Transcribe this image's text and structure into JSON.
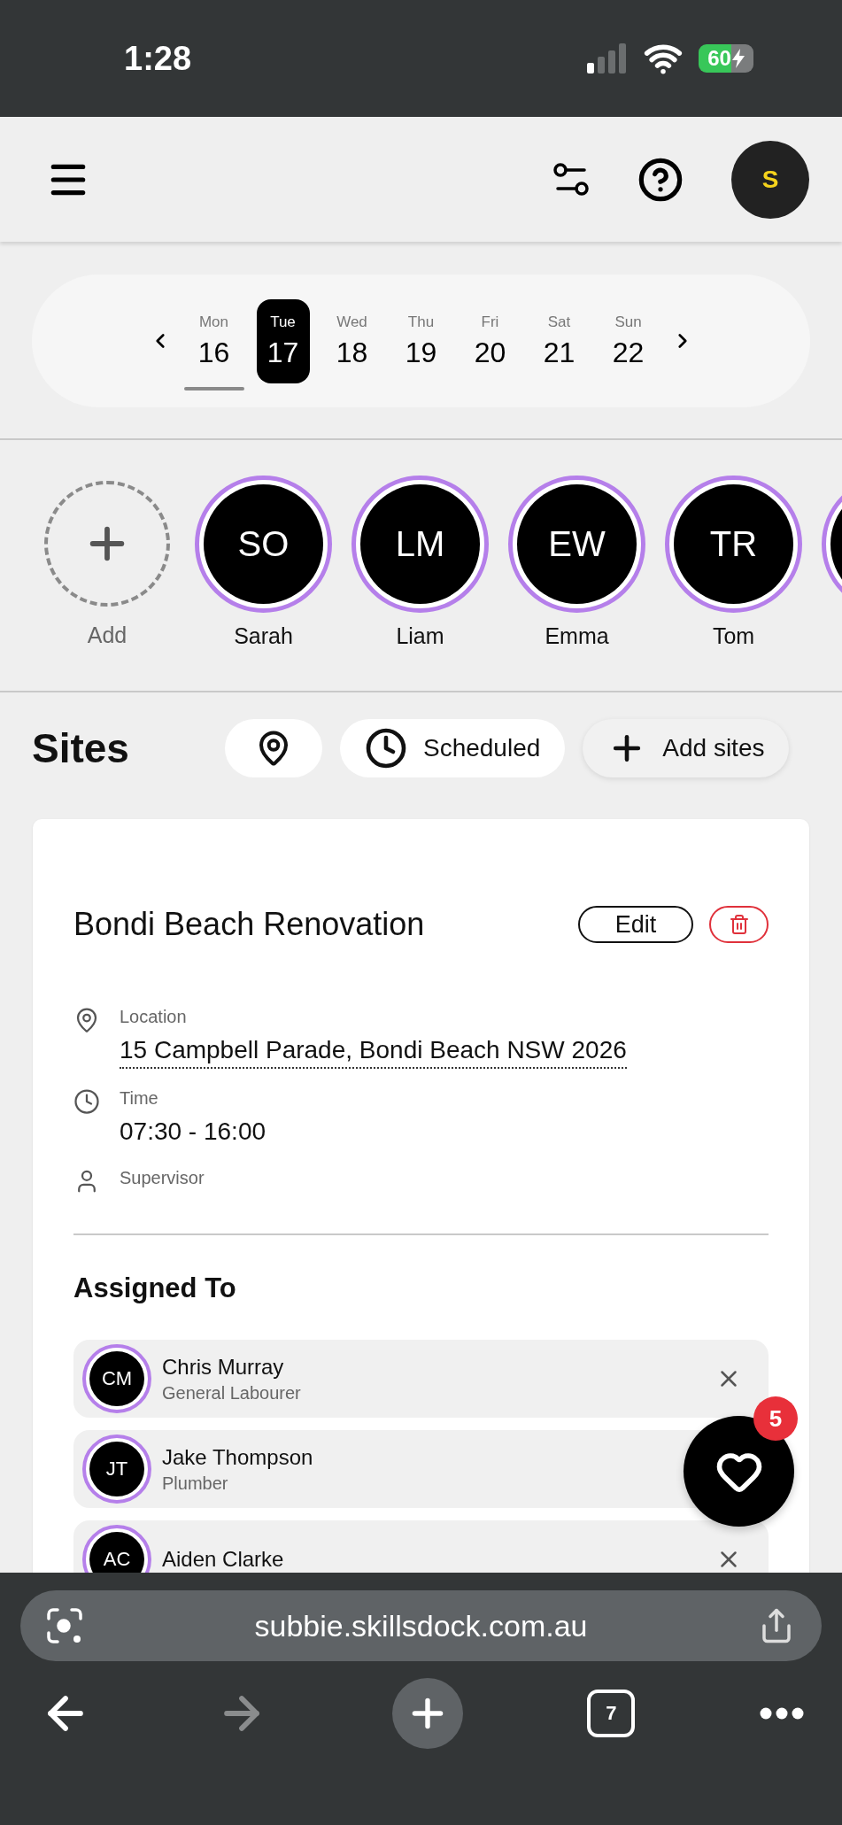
{
  "status_bar": {
    "time": "1:28",
    "battery": "60",
    "charging": true
  },
  "header": {
    "avatar_initial": "S"
  },
  "week": {
    "days": [
      {
        "weekday": "Mon",
        "date": "16",
        "selected": false,
        "today": true
      },
      {
        "weekday": "Tue",
        "date": "17",
        "selected": true,
        "today": false
      },
      {
        "weekday": "Wed",
        "date": "18",
        "selected": false,
        "today": false
      },
      {
        "weekday": "Thu",
        "date": "19",
        "selected": false,
        "today": false
      },
      {
        "weekday": "Fri",
        "date": "20",
        "selected": false,
        "today": false
      },
      {
        "weekday": "Sat",
        "date": "21",
        "selected": false,
        "today": false
      },
      {
        "weekday": "Sun",
        "date": "22",
        "selected": false,
        "today": false
      }
    ]
  },
  "staff": {
    "add_label": "Add",
    "members": [
      {
        "initials": "SO",
        "name": "Sarah"
      },
      {
        "initials": "LM",
        "name": "Liam"
      },
      {
        "initials": "EW",
        "name": "Emma"
      },
      {
        "initials": "TR",
        "name": "Tom"
      }
    ]
  },
  "sites": {
    "title": "Sites",
    "scheduled_label": "Scheduled",
    "add_label": "Add sites"
  },
  "site": {
    "title": "Bondi Beach Renovation",
    "edit_label": "Edit",
    "details": [
      {
        "kind": "location",
        "label": "Location",
        "value": "15 Campbell Parade, Bondi Beach NSW 2026"
      },
      {
        "kind": "time",
        "label": "Time",
        "value": "07:30 - 16:00"
      },
      {
        "kind": "supervisor",
        "label": "Supervisor"
      }
    ],
    "assigned_title": "Assigned To",
    "assigned": [
      {
        "initials": "CM",
        "name": "Chris Murray",
        "role": "General Labourer",
        "remove_shown": true
      },
      {
        "initials": "JT",
        "name": "Jake Thompson",
        "role": "Plumber",
        "remove_shown": false
      },
      {
        "initials": "AC",
        "name": "Aiden Clarke",
        "remove_shown": true
      }
    ]
  },
  "fab": {
    "badge": "5"
  },
  "browser": {
    "url": "subbie.skillsdock.com.au",
    "tab_count": "7",
    "forward_disabled": true
  }
}
